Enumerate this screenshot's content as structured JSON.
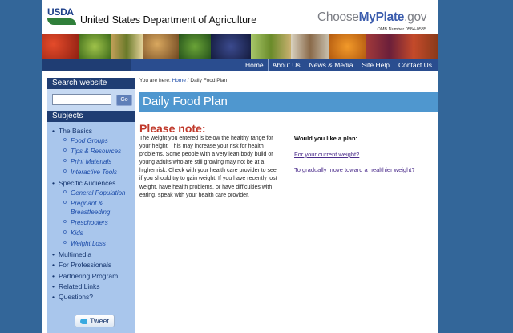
{
  "header": {
    "usda_logo_text": "USDA",
    "department": "United States Department of Agriculture",
    "choosemyplate_prefix": "Choose",
    "choosemyplate_bold": "MyPlate",
    "choosemyplate_suffix": ".gov",
    "omb_number": "OMB Number 0584-0535"
  },
  "nav": {
    "items": [
      "Home",
      "About Us",
      "News & Media",
      "Site Help",
      "Contact Us"
    ]
  },
  "sidebar": {
    "search_heading": "Search website",
    "search_value": "",
    "go_label": "Go",
    "subjects_heading": "Subjects",
    "items": [
      {
        "label": "The Basics",
        "level": 1
      },
      {
        "label": "Food Groups",
        "level": 2
      },
      {
        "label": "Tips & Resources",
        "level": 2
      },
      {
        "label": "Print Materials",
        "level": 2
      },
      {
        "label": "Interactive Tools",
        "level": 2
      },
      {
        "label": "Specific Audiences",
        "level": 1
      },
      {
        "label": "General Population",
        "level": 2
      },
      {
        "label": "Pregnant &",
        "label2": "Breastfeeding",
        "level": 2
      },
      {
        "label": "Preschoolers",
        "level": 2
      },
      {
        "label": "Kids",
        "level": 2
      },
      {
        "label": "Weight Loss",
        "level": 2
      },
      {
        "label": "Multimedia",
        "level": 1
      },
      {
        "label": "For Professionals",
        "level": 1
      },
      {
        "label": "Partnering Program",
        "level": 1
      },
      {
        "label": "Related Links",
        "level": 1
      },
      {
        "label": "Questions?",
        "level": 1
      }
    ],
    "tweet_label": "Tweet"
  },
  "main": {
    "breadcrumb_prefix": "You are here:",
    "breadcrumb_home": "Home",
    "breadcrumb_sep": "/",
    "breadcrumb_current": "Daily Food Plan",
    "title": "Daily Food Plan",
    "note_heading": "Please note:",
    "note_body": "The weight you entered is below the healthy range for your height. This may increase your risk for health problems. Some people with a very lean body build or young adults who are still growing may not be at a higher risk. Check with your health care provider to see if you should try to gain weight. If you have recently lost weight, have health problems, or have difficulties with eating, speak with your health care provider.",
    "plan_question": "Would you like a plan:",
    "plan_current": "For your current weight?",
    "plan_gradual": "To gradually move toward a healthier weight?"
  },
  "colors": {
    "background": "#336699",
    "nav_bar": "#2a4d8f",
    "sidebar": "#a9c6ec",
    "title_bar": "#4f97cf",
    "note_heading": "#c0392b",
    "link": "#4a2b8a"
  },
  "icons": [
    "usda-logo",
    "twitter-bird-icon"
  ]
}
